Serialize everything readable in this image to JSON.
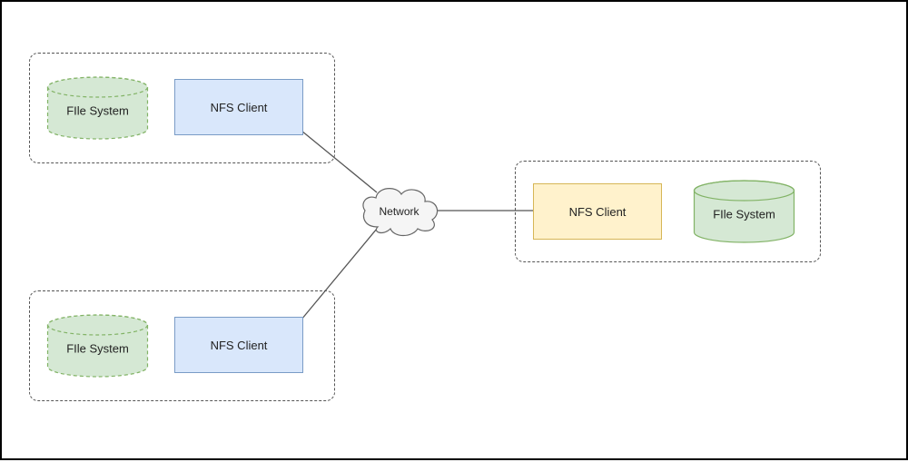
{
  "diagram": {
    "network_label": "Network",
    "nodes": {
      "client_top": {
        "nfs_label": "NFS Client",
        "fs_label": "FIle System"
      },
      "client_bottom": {
        "nfs_label": "NFS Client",
        "fs_label": "FIle System"
      },
      "server_right": {
        "nfs_label": "NFS Client",
        "fs_label": "FIle System"
      }
    }
  }
}
